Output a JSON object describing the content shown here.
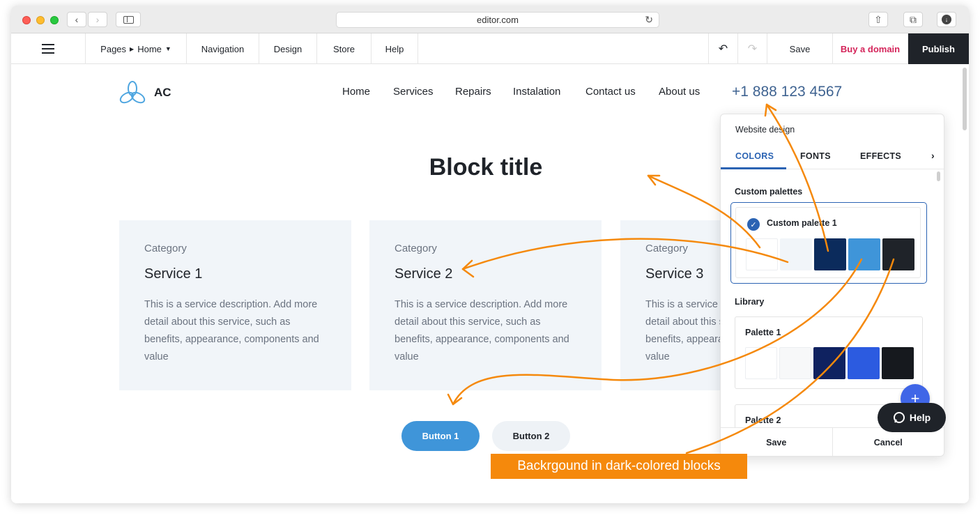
{
  "browser": {
    "url": "editor.com"
  },
  "toolbar": {
    "pages_label": "Pages",
    "home_label": "Home",
    "navigation_label": "Navigation",
    "design_label": "Design",
    "store_label": "Store",
    "help_label": "Help",
    "save_label": "Save",
    "buy_domain_label": "Buy a domain",
    "publish_label": "Publish",
    "colors": {
      "buy_domain": "#d4245a",
      "publish_bg": "#1f2329"
    }
  },
  "site": {
    "logo_text": "AC",
    "nav": [
      "Home",
      "Services",
      "Repairs",
      "Instalation",
      "Contact us",
      "About us"
    ],
    "phone": "+1 888 123 4567",
    "block_title": "Block title",
    "cards": [
      {
        "category": "Category",
        "title": "Service 1",
        "description": "This is a service description. Add more detail about this service, such as benefits, appearance, components and value"
      },
      {
        "category": "Category",
        "title": "Service 2",
        "description": "This is a service description. Add more detail about this service, such as benefits, appearance, components and value"
      },
      {
        "category": "Category",
        "title": "Service 3",
        "description": "This is a service description. Add more detail about this service, such as benefits, appearance, components and value"
      }
    ],
    "button1_label": "Button 1",
    "button2_label": "Button 2"
  },
  "panel": {
    "title": "Website design",
    "tabs": [
      "COLORS",
      "FONTS",
      "EFFECTS"
    ],
    "active_tab": "COLORS",
    "custom_palettes_label": "Custom palettes",
    "custom_palette": {
      "name": "Custom palette 1",
      "colors": [
        "#ffffff",
        "#f1f5f9",
        "#0b2b5c",
        "#3f95d9",
        "#1f2329"
      ]
    },
    "library_label": "Library",
    "library": [
      {
        "name": "Palette 1",
        "colors": [
          "#ffffff",
          "#f7f8f9",
          "#0f2260",
          "#2c5be0",
          "#16191e"
        ]
      },
      {
        "name": "Palette 2",
        "colors": []
      }
    ],
    "save_label": "Save",
    "cancel_label": "Cancel"
  },
  "help_button_label": "Help",
  "annotation_label": "Backrgound in dark-colored blocks",
  "annotation_color": "#f5890c"
}
